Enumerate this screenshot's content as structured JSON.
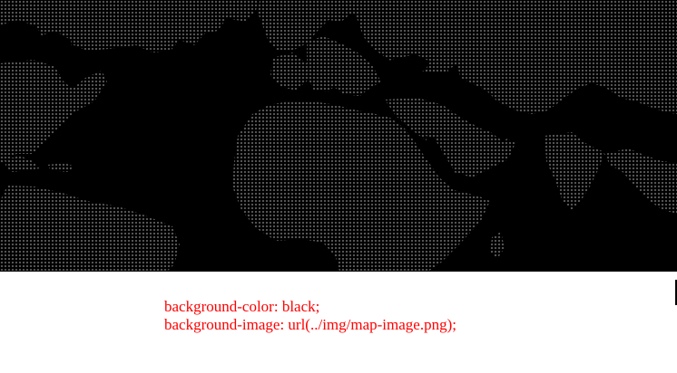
{
  "map_panel": {
    "background_color": "#000000",
    "dot_color": "#5a5a5a",
    "content": "dotted-world-map"
  },
  "caption": {
    "line_1": "background-color: black;",
    "line_2": "background-image: url(../img/map-image.png);",
    "color": "#ff0000"
  }
}
